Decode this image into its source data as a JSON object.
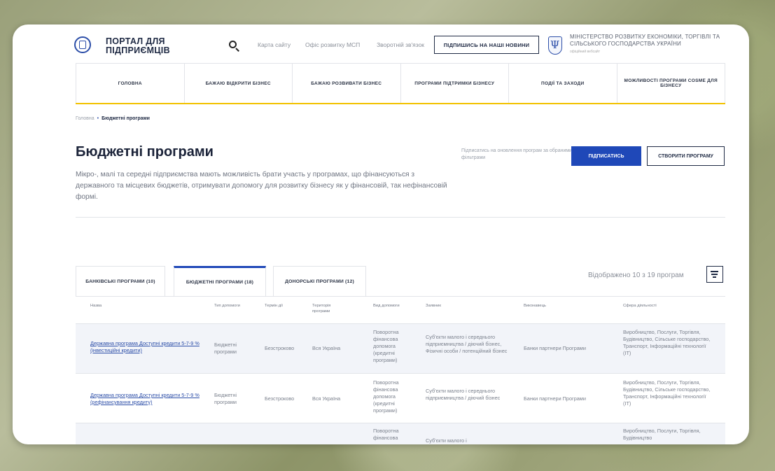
{
  "header": {
    "portal_title": "ПОРТАЛ ДЛЯ ПІДПРИЄМЦІВ",
    "links": [
      "Карта сайту",
      "Офіс розвитку МСП",
      "Зворотній зв'язок"
    ],
    "subscribe_news": "ПІДПИШИСЬ НА НАШІ НОВИНИ",
    "ministry": "МІНІСТЕРСТВО РОЗВИТКУ ЕКОНОМІКИ, ТОРГІВЛІ ТА СІЛЬСЬКОГО ГОСПОДАРСТВА УКРАЇНИ",
    "ministry_sub": "офіційний вебсайт"
  },
  "nav": [
    "ГОЛОВНА",
    "БАЖАЮ ВІДКРИТИ БІЗНЕС",
    "БАЖАЮ РОЗВИВАТИ БІЗНЕС",
    "ПРОГРАМИ ПІДТРИМКИ БІЗНЕСУ",
    "ПОДІЇ ТА ЗАХОДИ",
    "МОЖЛИВОСТІ ПРОГРАМИ COSME ДЛЯ БІЗНЕСУ"
  ],
  "breadcrumb": {
    "home": "Головна",
    "sep": "•",
    "current": "Бюджетні програми"
  },
  "page": {
    "title": "Бюджетні програми",
    "description": "Мікро-, малі та середні підприємства мають можливість брати участь у програмах, що фінансуються з державного та місцевих бюджетів, отримувати допомогу для розвитку бізнесу як у фінансовій, так нефінансовій формі.",
    "subscribe_hint": "Підписатись на оновлення програм за обраними фільтрами",
    "subscribe_btn": "ПІДПИСАТИСЬ",
    "create_btn": "СТВОРИТИ ПРОГРАМУ"
  },
  "tabs": [
    {
      "label": "БАНКІВСЬКІ ПРОГРАМИ (10)"
    },
    {
      "label": "БЮДЖЕТНІ ПРОГРАМИ (18)"
    },
    {
      "label": "ДОНОРСЬКІ ПРОГРАМИ (12)"
    }
  ],
  "shown_count": "Відображено 10 з 19 програм",
  "table": {
    "headers": [
      "Назва",
      "Тип допомоги",
      "Термін дії",
      "Територія програми",
      "Вид допомоги",
      "Заявник",
      "Виконавець",
      "Сфера діяльності"
    ],
    "rows": [
      [
        "Державна програма Доступні кредити 5-7-9 % (інвестиційні кредити)",
        "Бюджетні програми",
        "Безстроково",
        "Вся Україна",
        "Поворотна фінансова допомога (кредитні програми)",
        "Суб'єкти малого і середнього підприємництва / діючий бізнес, Фізичні особи / потенційний бізнес",
        "Банки партнери Програми",
        "Виробництво, Послуги, Торгівля, Будівництво, Сільське господарство, Транспорт, Інформаційні технології (IT)"
      ],
      [
        "Державна програма Доступні кредити 5-7-9 % (рефінансування кредиту)",
        "Бюджетні програми",
        "Безстроково",
        "Вся Україна",
        "Поворотна фінансова допомога (кредитні програми)",
        "Суб'єкти малого і середнього підприємництва / діючий бізнес",
        "Банки партнери Програми",
        "Виробництво, Послуги, Торгівля, Будівництво, Сільське господарство, Транспорт, Інформаційні технології (IT)"
      ],
      [
        "",
        "",
        "",
        "",
        "Поворотна фінансова",
        "Суб'єкти малого і",
        "",
        "Виробництво, Послуги, Торгівля, Будівництво"
      ]
    ]
  }
}
